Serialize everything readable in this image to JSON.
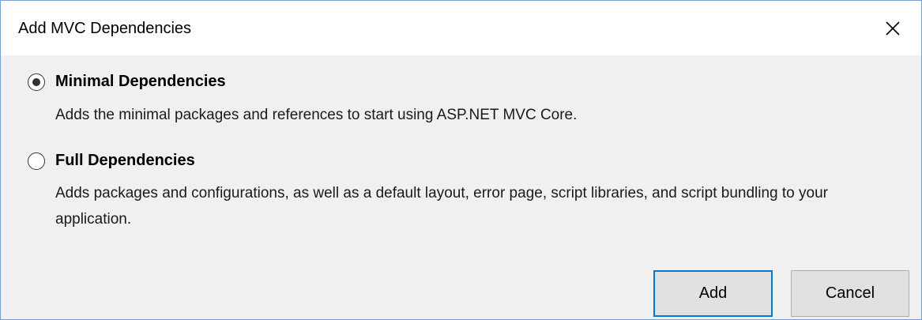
{
  "dialog": {
    "title": "Add MVC Dependencies",
    "close_icon": "close-icon"
  },
  "options": [
    {
      "label": "Minimal Dependencies",
      "description": "Adds the minimal packages and references to start using ASP.NET MVC Core.",
      "selected": true
    },
    {
      "label": "Full Dependencies",
      "description": "Adds packages and configurations, as well as a default layout, error page, script libraries, and script bundling to your application.",
      "selected": false
    }
  ],
  "buttons": {
    "add_label": "Add",
    "cancel_label": "Cancel"
  },
  "colors": {
    "accent": "#0078d7",
    "client_background": "#f0f0f0",
    "window_border": "#7a9fc9"
  }
}
